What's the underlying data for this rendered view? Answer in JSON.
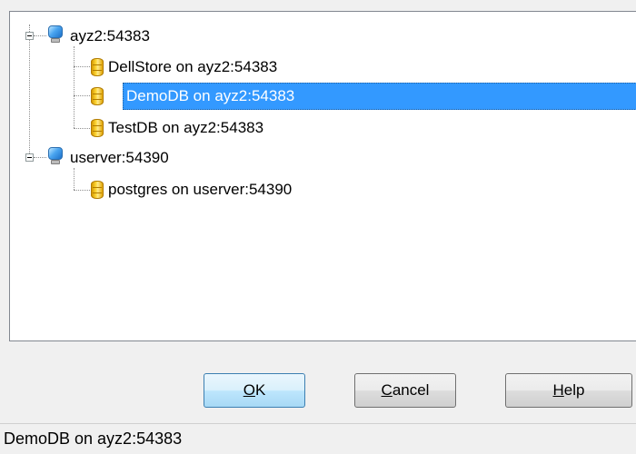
{
  "tree": {
    "servers": [
      {
        "label": "ayz2:54383",
        "databases": [
          {
            "label": "DellStore on ayz2:54383",
            "selected": false
          },
          {
            "label": "DemoDB on ayz2:54383",
            "selected": true
          },
          {
            "label": "TestDB on ayz2:54383",
            "selected": false
          }
        ]
      },
      {
        "label": "userver:54390",
        "databases": [
          {
            "label": "postgres on userver:54390",
            "selected": false
          }
        ]
      }
    ]
  },
  "buttons": {
    "ok": {
      "accel": "O",
      "rest": "K"
    },
    "cancel": {
      "accel": "C",
      "rest": "ancel"
    },
    "help": {
      "accel": "H",
      "rest": "elp"
    }
  },
  "status_bar": {
    "text": "DemoDB on ayz2:54383"
  },
  "colors": {
    "selection": "#3399ff",
    "default_button_border": "#3c7fb1"
  }
}
